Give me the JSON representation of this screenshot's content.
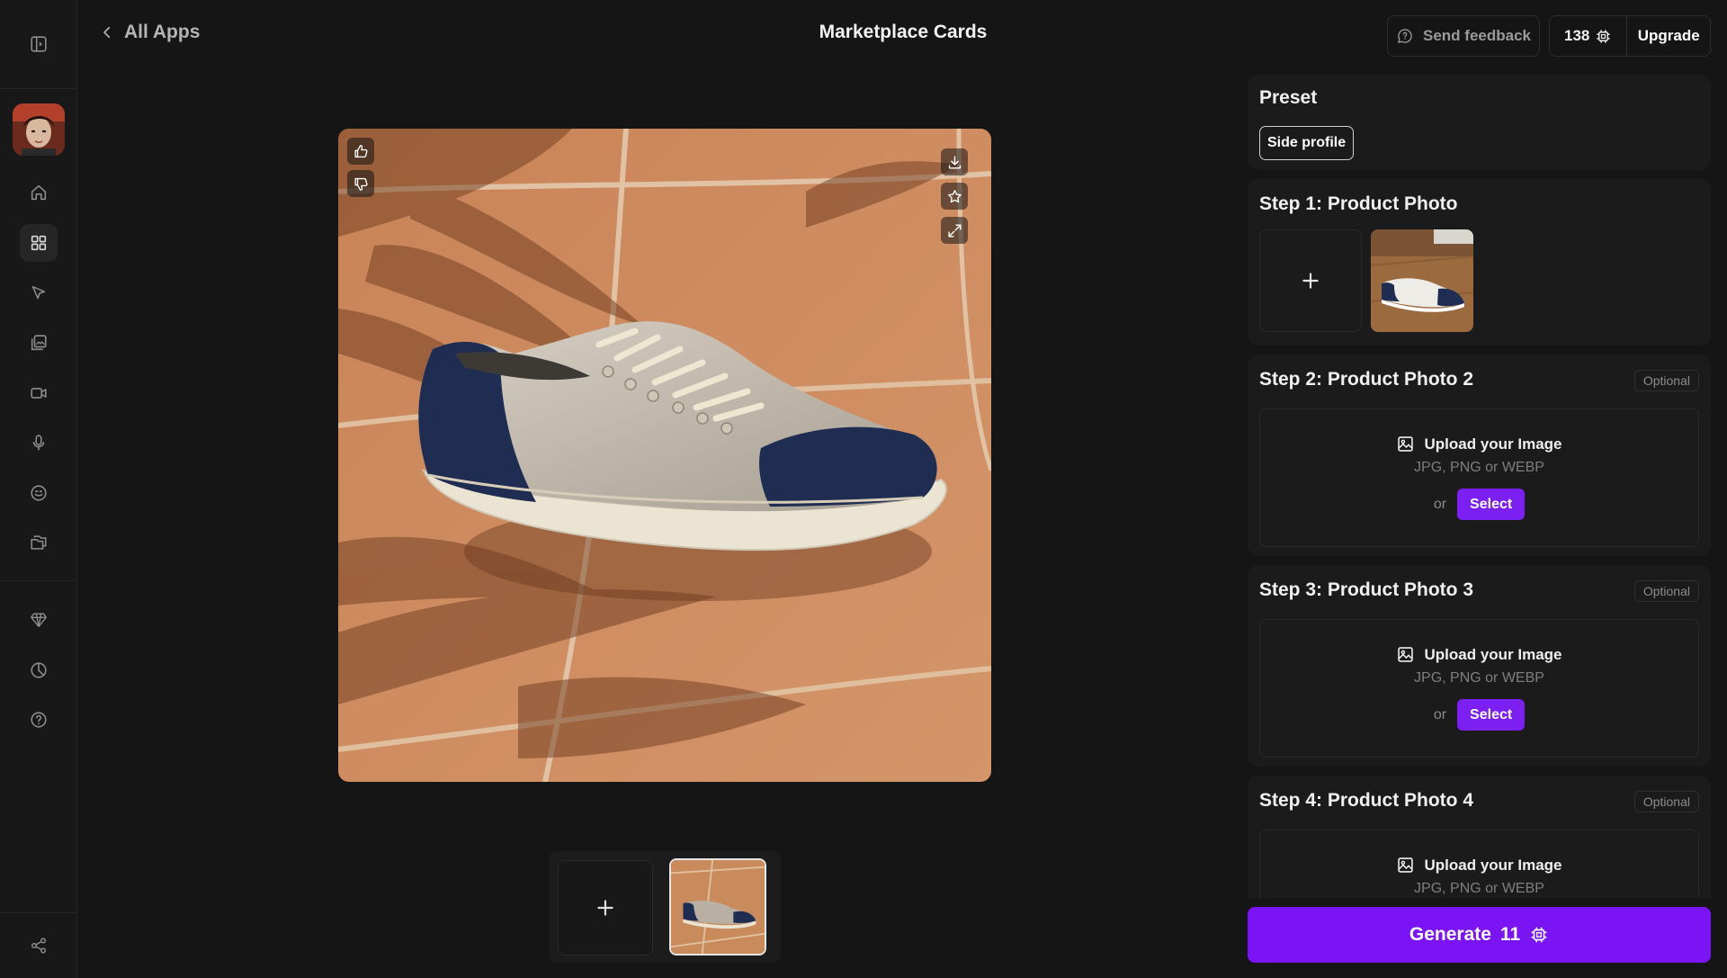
{
  "topbar": {
    "back_label": "All Apps",
    "title": "Marketplace Cards",
    "feedback_label": "Send feedback",
    "credits": "138",
    "upgrade_label": "Upgrade"
  },
  "sidebar": {
    "items": [
      {
        "name": "home-icon"
      },
      {
        "name": "apps-grid-icon",
        "active": true
      },
      {
        "name": "cursor-icon"
      },
      {
        "name": "image-edit-icon"
      },
      {
        "name": "video-icon"
      },
      {
        "name": "microphone-icon"
      },
      {
        "name": "face-icon"
      },
      {
        "name": "folder-icon"
      },
      {
        "name": "diamond-icon"
      },
      {
        "name": "chart-pie-icon"
      },
      {
        "name": "help-icon"
      },
      {
        "name": "share-icon"
      }
    ]
  },
  "preview": {
    "actions_left": [
      "thumbs-up-icon",
      "thumbs-down-icon"
    ],
    "actions_right": [
      "download-icon",
      "star-icon",
      "expand-icon"
    ]
  },
  "panel": {
    "preset": {
      "title": "Preset",
      "chip": "Side profile"
    },
    "steps": [
      {
        "title": "Step 1: Product Photo"
      },
      {
        "title": "Step 2: Product Photo 2",
        "optional": "Optional"
      },
      {
        "title": "Step 3: Product Photo 3",
        "optional": "Optional"
      },
      {
        "title": "Step 4: Product Photo 4",
        "optional": "Optional"
      }
    ],
    "upload": {
      "title": "Upload your Image",
      "formats": "JPG, PNG or WEBP",
      "or": "or",
      "select": "Select"
    }
  },
  "generate": {
    "label": "Generate",
    "cost": "11"
  },
  "colors": {
    "accent": "#7b14f5",
    "background": "#151515",
    "panel": "#1b1b1b"
  }
}
